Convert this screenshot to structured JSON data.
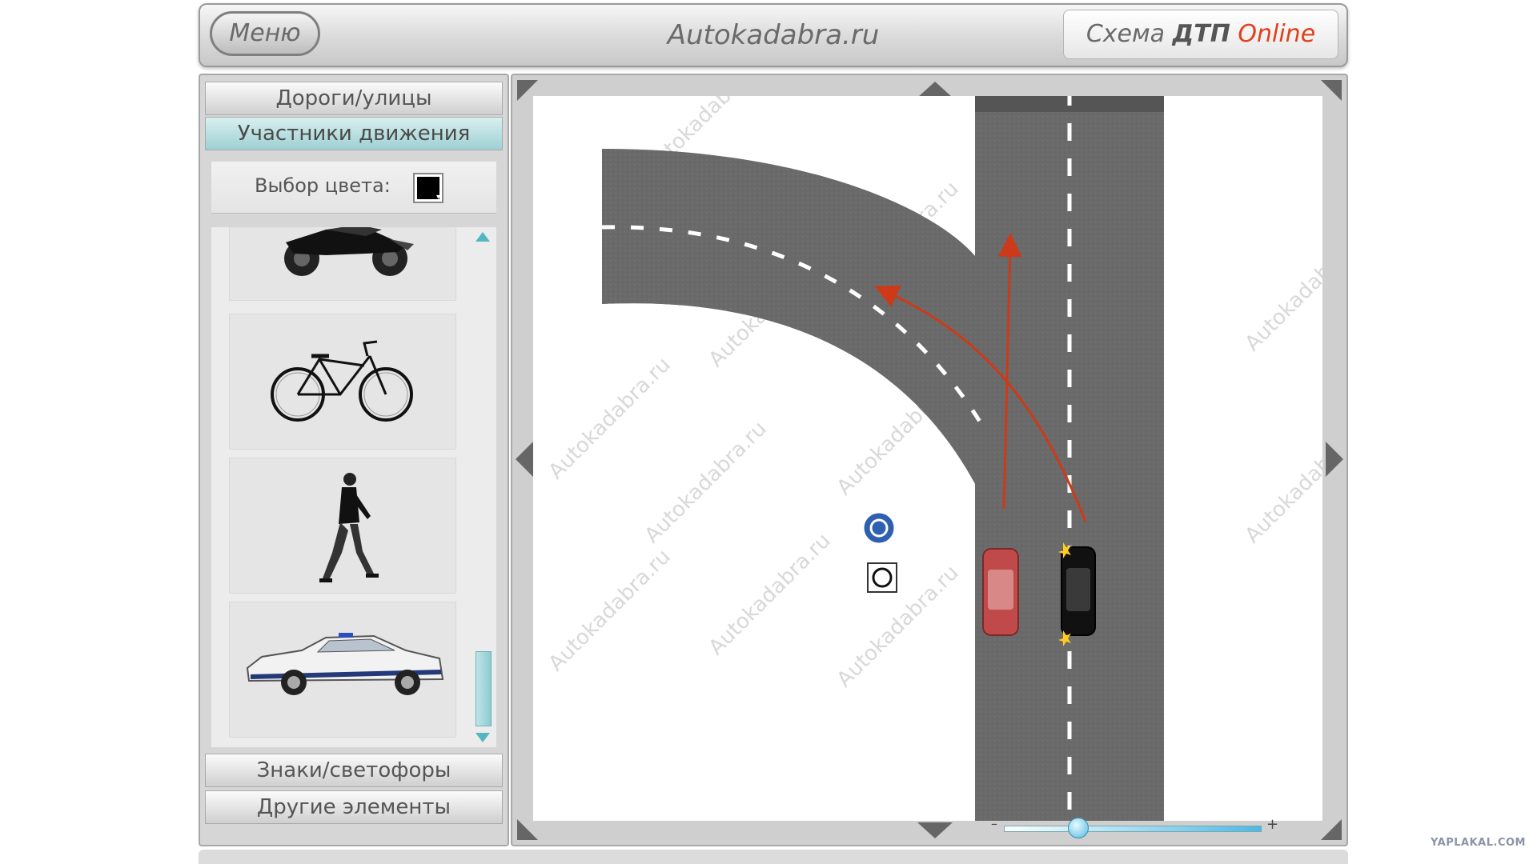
{
  "header": {
    "menu_label": "Меню",
    "site_title": "Autokadabra.ru",
    "brand_prefix": "Схема ",
    "brand_bold": "ДТП",
    "brand_online": " Online"
  },
  "sidebar": {
    "sections": [
      {
        "label": "Дороги/улицы",
        "active": false
      },
      {
        "label": "Участники движения",
        "active": true
      },
      {
        "label": "Знаки/светофоры",
        "active": false
      },
      {
        "label": "Другие элементы",
        "active": false
      }
    ],
    "color_label": "Выбор цвета:",
    "selected_color": "#000000",
    "palette_items": [
      {
        "name": "motorcycle",
        "icon": "motorcycle-icon"
      },
      {
        "name": "bicycle",
        "icon": "bicycle-icon"
      },
      {
        "name": "pedestrian",
        "icon": "pedestrian-icon"
      },
      {
        "name": "police-car",
        "icon": "police-car-icon"
      }
    ]
  },
  "canvas": {
    "watermark_text": "Autokadabra.ru",
    "objects": [
      {
        "type": "red-car",
        "color": "#c04a4a"
      },
      {
        "type": "black-car",
        "color": "#111111"
      },
      {
        "type": "roundabout-sign",
        "color": "#2f5fb0"
      },
      {
        "type": "target-marker"
      }
    ],
    "path_color": "#cc3a1a",
    "zoom": {
      "minus": "–",
      "plus": "+",
      "level": 0.12
    }
  },
  "corner_watermark": "YAPLAKAL.COM"
}
